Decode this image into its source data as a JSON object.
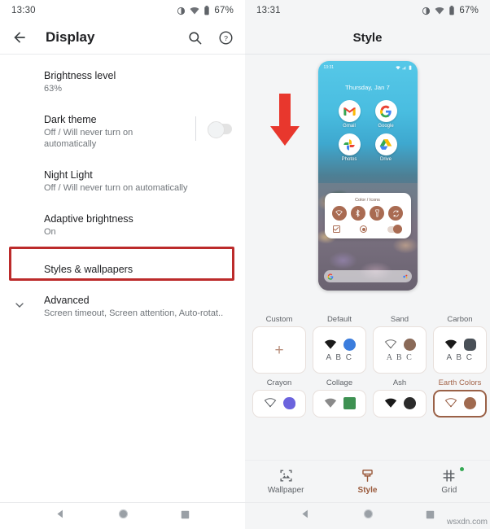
{
  "left_screen": {
    "status_bar": {
      "time": "13:30",
      "battery": "67%"
    },
    "toolbar": {
      "title": "Display",
      "back_icon": "back-arrow-icon",
      "search_icon": "search-icon",
      "help_icon": "help-icon"
    },
    "settings": [
      {
        "title": "Brightness level",
        "subtitle": "63%"
      },
      {
        "title": "Dark theme",
        "subtitle": "Off / Will never turn on automatically",
        "toggle": "off"
      },
      {
        "title": "Night Light",
        "subtitle": "Off / Will never turn on automatically"
      },
      {
        "title": "Adaptive brightness",
        "subtitle": "On"
      },
      {
        "title": "Styles & wallpapers",
        "subtitle": "",
        "highlighted": true
      },
      {
        "title": "Advanced",
        "subtitle": "Screen timeout, Screen attention, Auto-rotat..",
        "chevron": "chevron-down-icon"
      }
    ],
    "highlight_color": "#bc2b2b"
  },
  "right_screen": {
    "status_bar": {
      "time": "13:31",
      "battery": "67%"
    },
    "header": {
      "title": "Style"
    },
    "preview": {
      "phone_time": "13:31",
      "date": "Thursday, Jan 7",
      "apps": [
        {
          "name": "Gmail",
          "icon": "gmail-icon"
        },
        {
          "name": "Google",
          "icon": "google-icon"
        },
        {
          "name": "Photos",
          "icon": "photos-icon"
        },
        {
          "name": "Drive",
          "icon": "drive-icon"
        }
      ],
      "quick_settings": {
        "title": "Color / Icons",
        "tiles": [
          "wifi-icon",
          "bluetooth-icon",
          "flashlight-icon",
          "auto-rotate-icon"
        ],
        "accent_color": "#a96b52"
      },
      "search_bar": {
        "left_icon": "google-g-icon",
        "right_icon": "assistant-icon"
      }
    },
    "annotation": {
      "arrow": "red-down-arrow",
      "color": "#e53935",
      "points_to": "Custom"
    },
    "styles": [
      {
        "label": "Custom",
        "type": "add",
        "plus": "+",
        "selected": false
      },
      {
        "label": "Default",
        "wifi_color": "#1a1a1a",
        "dot_color": "#3b7ddd",
        "font_sample": "A B C",
        "dot_shape": "circle",
        "selected": false
      },
      {
        "label": "Sand",
        "wifi_color": "#707070",
        "dot_color": "#8a6a58",
        "font_sample": "A B C",
        "dot_shape": "circle",
        "selected": false
      },
      {
        "label": "Carbon",
        "wifi_color": "#1a1a1a",
        "dot_color": "#495057",
        "font_sample": "A B C",
        "dot_shape": "squircle",
        "selected": false
      },
      {
        "label": "Crayon",
        "wifi_color": "#5f6368",
        "dot_color": "#6b63dd",
        "dot_shape": "blob",
        "selected": false
      },
      {
        "label": "Collage",
        "wifi_color": "#8a8a8a",
        "dot_color": "#3e9152",
        "dot_shape": "square",
        "selected": false
      },
      {
        "label": "Ash",
        "wifi_color": "#1a1a1a",
        "dot_color": "#2b2b2b",
        "dot_shape": "circle",
        "selected": false
      },
      {
        "label": "Earth Colors",
        "wifi_color": "#9a6147",
        "dot_color": "#a06a4f",
        "dot_shape": "circle",
        "selected": true
      }
    ],
    "bottom_nav": [
      {
        "label": "Wallpaper",
        "icon": "wallpaper-icon",
        "active": false,
        "badge": false
      },
      {
        "label": "Style",
        "icon": "paintbrush-icon",
        "active": true,
        "badge": false
      },
      {
        "label": "Grid",
        "icon": "grid-icon",
        "active": false,
        "badge": true
      }
    ]
  },
  "system_nav": {
    "back": "back-triangle-icon",
    "home": "home-circle-icon",
    "recents": "recents-square-icon"
  },
  "watermark": "wsxdn.com"
}
